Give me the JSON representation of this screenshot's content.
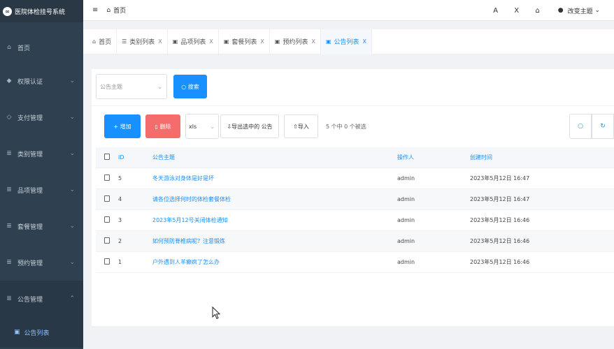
{
  "app": {
    "title": "医院体检挂号系统",
    "logo_glyph": "∞"
  },
  "sidebar": {
    "home_label": "首页",
    "items": [
      {
        "label": "权限认证"
      },
      {
        "label": "支付管理"
      },
      {
        "label": "类别管理"
      },
      {
        "label": "品项管理"
      },
      {
        "label": "套餐管理"
      },
      {
        "label": "预约管理"
      },
      {
        "label": "公告管理"
      }
    ],
    "sub_item_label": "公告列表"
  },
  "topbar": {
    "menu_glyph": "≡",
    "breadcrumb": "首页",
    "font_glyph": "A",
    "fullscreen_glyph": "X",
    "theme_label": "改变主题"
  },
  "tabs": [
    {
      "label": "首页",
      "closable": false
    },
    {
      "label": "类别列表",
      "close": "X"
    },
    {
      "label": "品项列表",
      "close": "X"
    },
    {
      "label": "套餐列表",
      "close": "X"
    },
    {
      "label": "预约列表",
      "close": "X"
    },
    {
      "label": "公告列表",
      "close": "X",
      "active": true
    }
  ],
  "search": {
    "subject_placeholder": "公告主题",
    "button_label": "搜索"
  },
  "toolbar": {
    "add_label": "增加",
    "delete_label": "删除",
    "format_value": "xls",
    "export_label": "导出选中的 公告",
    "import_label": "导入",
    "selected_text": "5 个中 0 个被选"
  },
  "table": {
    "headers": {
      "id": "ID",
      "title": "公告主题",
      "operator": "操作人",
      "created": "创建时间"
    },
    "rows": [
      {
        "id": "5",
        "title": "冬天游泳对身体是好是坏",
        "operator": "admin",
        "created": "2023年5月12日 16:47"
      },
      {
        "id": "4",
        "title": "请各位选择何时的体检套餐体检",
        "operator": "admin",
        "created": "2023年5月12日 16:47"
      },
      {
        "id": "3",
        "title": "2023年5月12号关闭体检通知",
        "operator": "admin",
        "created": "2023年5月12日 16:46"
      },
      {
        "id": "2",
        "title": "如何预防脊椎病呢？注意锻炼",
        "operator": "admin",
        "created": "2023年5月12日 16:46"
      },
      {
        "id": "1",
        "title": "户外遇到人羊癫疯了怎么办",
        "operator": "admin",
        "created": "2023年5月12日 16:46"
      }
    ]
  },
  "colors": {
    "sidebar_bg": "#2f4050",
    "primary": "#1890ff",
    "danger": "#f56c6c"
  }
}
